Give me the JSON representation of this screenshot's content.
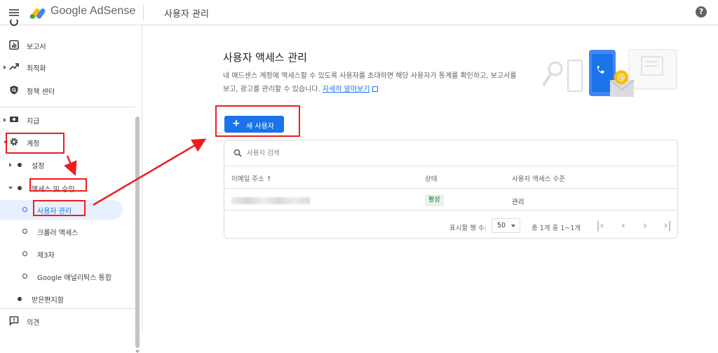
{
  "topbar": {
    "brand": "Google AdSense",
    "page_title": "사용자 관리",
    "help_glyph": "?"
  },
  "sidebar": {
    "items": [
      {
        "label": "보고서",
        "icon": "report-icon"
      },
      {
        "label": "최적화",
        "icon": "trending-up-icon"
      },
      {
        "label": "정책 센터",
        "icon": "policy-shield-icon"
      },
      {
        "label": "지급",
        "icon": "payments-icon"
      },
      {
        "label": "계정",
        "icon": "gear-icon"
      },
      {
        "label": "설정"
      },
      {
        "label": "액세스 및 승인"
      },
      {
        "label": "사용자 관리",
        "active": true
      },
      {
        "label": "크롤러 액세스"
      },
      {
        "label": "제3자"
      },
      {
        "label": "Google 애널리틱스 통합"
      },
      {
        "label": "받은편지함"
      },
      {
        "label": "의견",
        "icon": "feedback-icon"
      }
    ]
  },
  "main": {
    "heading": "사용자 액세스 관리",
    "description": "내 애드센스 계정에 액세스할 수 있도록 사용자를 초대하면 해당 사용자가 통계를 확인하고, 보고서를 보고, 광고를 관리할 수 있습니다.",
    "learn_more": "자세히 알아보기",
    "new_user_button": "새 사용자",
    "search_placeholder": "사용자 검색"
  },
  "table": {
    "columns": [
      "이메일 주소 ↑",
      "상태",
      "사용자 액세스 수준"
    ],
    "rows": [
      {
        "email": "",
        "status": "활성",
        "access": "관리"
      }
    ],
    "footer": {
      "rows_per_page_label": "표시할 행 수:",
      "rows_per_page": "50",
      "range": "총 1개 중 1~1개"
    },
    "pager_icons": [
      "first-page-icon",
      "prev-page-icon",
      "next-page-icon",
      "last-page-icon"
    ]
  },
  "colors": {
    "accent": "#1a73e8",
    "annotation": "#ee1d1d",
    "status_bg": "#e6f4ea",
    "status_fg": "#137333"
  }
}
